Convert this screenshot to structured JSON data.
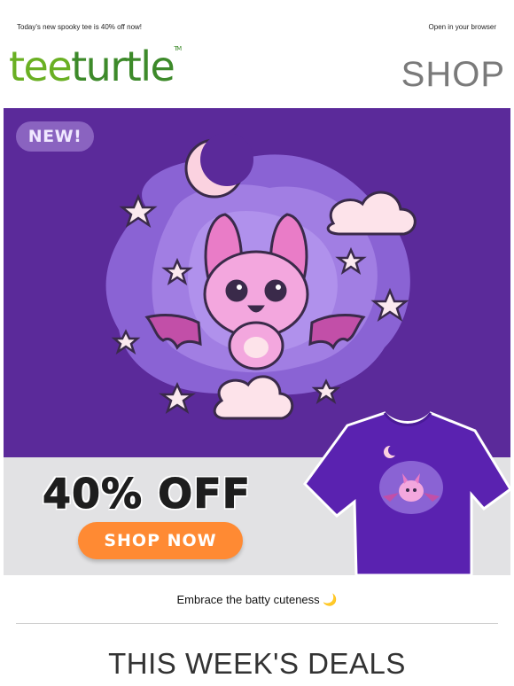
{
  "header": {
    "preheader_text": "Today's new spooky tee is 40% off now!",
    "browser_link": "Open in your browser",
    "logo_part1": "tee",
    "logo_part2": "turtle",
    "logo_tm": "TM",
    "shop_link": "SHOP"
  },
  "hero": {
    "badge": "NEW!",
    "discount": "40% OFF",
    "cta": "SHOP NOW",
    "colors": {
      "background": "#5b2a9a",
      "cta": "#ff8a33",
      "panel": "#e2e2e4"
    }
  },
  "tagline": "Embrace the batty cuteness 🌙",
  "section_title": "THIS WEEK'S DEALS"
}
